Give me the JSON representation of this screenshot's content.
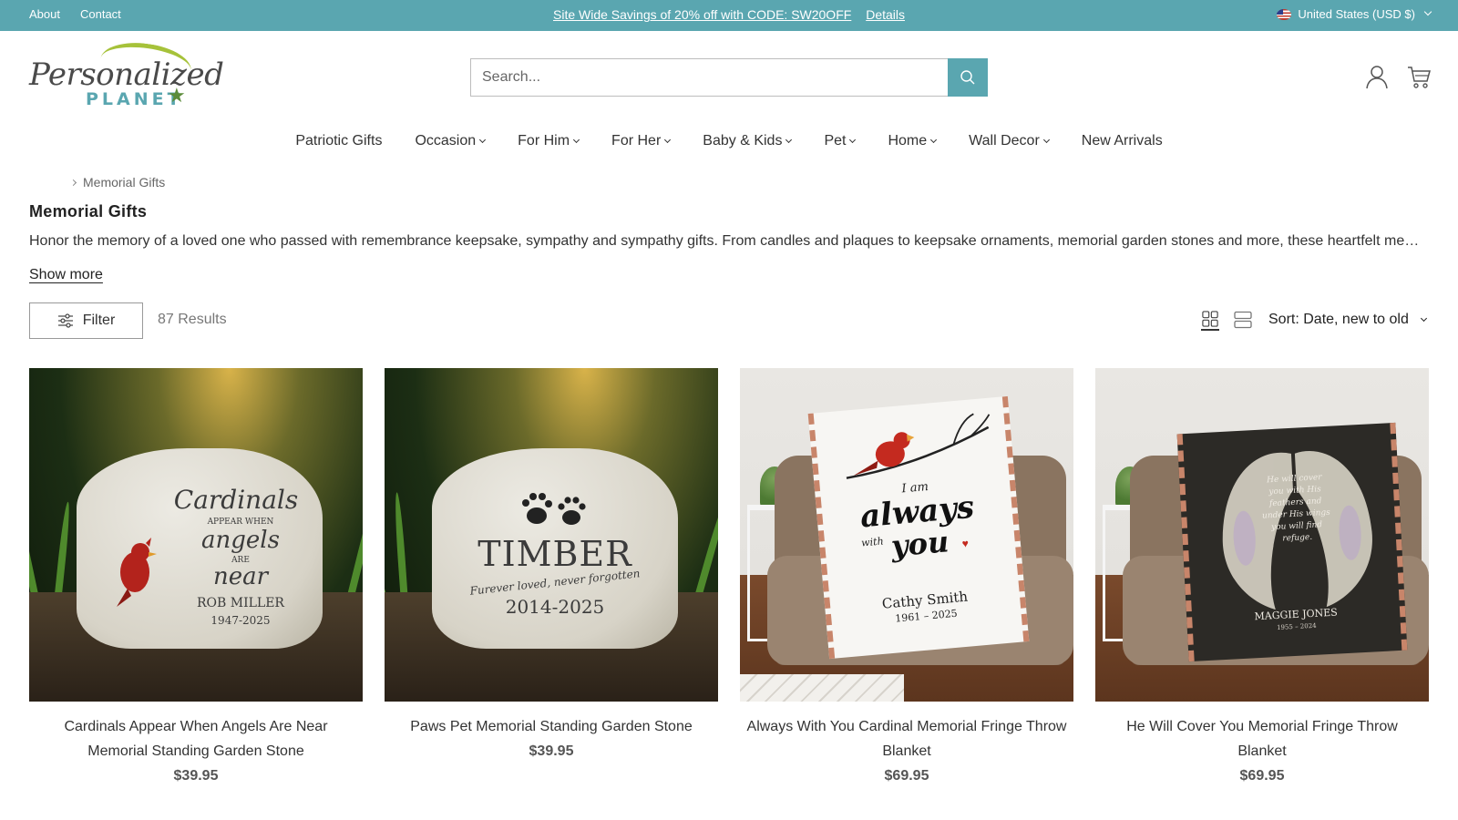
{
  "topbar": {
    "links": [
      "About",
      "Contact"
    ],
    "promo_text": "Site Wide Savings of 20% off with CODE: SW20OFF",
    "promo_link": "Details",
    "currency": "United States (USD $)",
    "bg_color": "#5aa6b0"
  },
  "logo": {
    "script": "Personalized",
    "word": "PLANET",
    "star": "★"
  },
  "search": {
    "placeholder": "Search..."
  },
  "nav": [
    {
      "label": "Patriotic Gifts",
      "dropdown": false
    },
    {
      "label": "Occasion",
      "dropdown": true
    },
    {
      "label": "For Him",
      "dropdown": true
    },
    {
      "label": "For Her",
      "dropdown": true
    },
    {
      "label": "Baby & Kids",
      "dropdown": true
    },
    {
      "label": "Pet",
      "dropdown": true
    },
    {
      "label": "Home",
      "dropdown": true
    },
    {
      "label": "Wall Decor",
      "dropdown": true
    },
    {
      "label": "New Arrivals",
      "dropdown": false
    }
  ],
  "breadcrumb": {
    "current": "Memorial Gifts"
  },
  "page": {
    "title": "Memorial Gifts",
    "description": "Honor the memory of a loved one who passed with remembrance keepsake, sympathy and sympathy gifts. From candles and plaques to keepsake ornaments, memorial garden stones and more, these heartfelt memorial gifts",
    "show_more": "Show more"
  },
  "toolbar": {
    "filter_label": "Filter",
    "results": "87 Results",
    "sort_label": "Sort: Date, new to old"
  },
  "products": [
    {
      "name": "Cardinals Appear When Angels Are Near Memorial Standing Garden Stone",
      "price": "$39.95",
      "image": {
        "lines": [
          "Cardinals",
          "APPEAR WHEN",
          "angels",
          "ARE",
          "near",
          "ROB MILLER",
          "1947-2025"
        ]
      }
    },
    {
      "name": "Paws Pet Memorial Standing Garden Stone",
      "price": "$39.95",
      "image": {
        "lines": [
          "TIMBER",
          "Furever loved, never forgotten",
          "2014-2025"
        ]
      }
    },
    {
      "name": "Always With You Cardinal Memorial Fringe Throw Blanket",
      "price": "$69.95",
      "image": {
        "lines": [
          "I am",
          "always",
          "with",
          "you",
          "Cathy Smith",
          "1961 – 2025"
        ]
      }
    },
    {
      "name": "He Will Cover You Memorial Fringe Throw Blanket",
      "price": "$69.95",
      "image": {
        "lines": [
          "He will cover you with His feathers and under His wings you will find refuge.",
          "MAGGIE JONES",
          "1955 – 2024"
        ]
      }
    }
  ]
}
